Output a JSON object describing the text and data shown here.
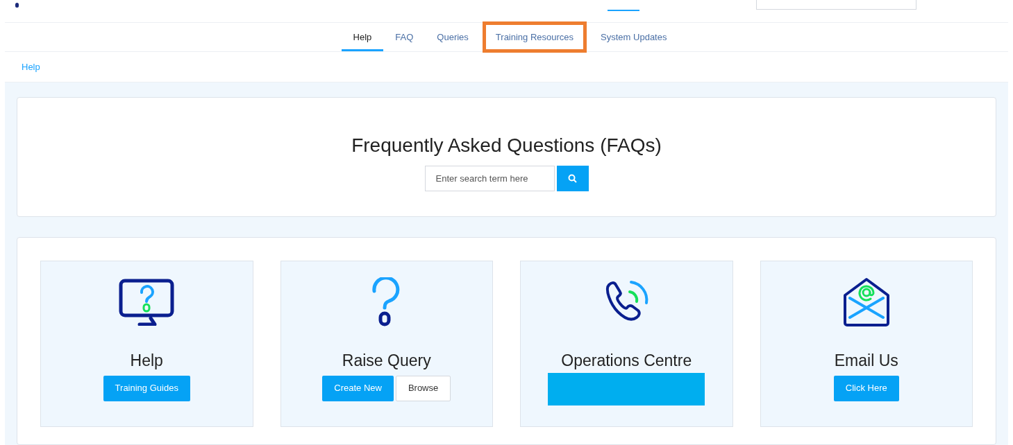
{
  "tabs": [
    {
      "label": "Help",
      "selected": true,
      "highlighted": false
    },
    {
      "label": "FAQ",
      "selected": false,
      "highlighted": false
    },
    {
      "label": "Queries",
      "selected": false,
      "highlighted": false
    },
    {
      "label": "Training Resources",
      "selected": false,
      "highlighted": true
    },
    {
      "label": "System Updates",
      "selected": false,
      "highlighted": false
    }
  ],
  "breadcrumb": "Help",
  "faq": {
    "title": "Frequently Asked Questions (FAQs)",
    "search": {
      "placeholder": "Enter search term here"
    }
  },
  "cards": [
    {
      "kind": "monitor",
      "title": "Help",
      "buttons": [
        {
          "label": "Training Guides",
          "primary": true
        }
      ]
    },
    {
      "kind": "question",
      "title": "Raise Query",
      "buttons": [
        {
          "label": "Create New",
          "primary": true
        },
        {
          "label": "Browse",
          "primary": false
        }
      ]
    },
    {
      "kind": "phone",
      "title": "Operations Centre",
      "redacted": true
    },
    {
      "kind": "mail",
      "title": "Email Us",
      "buttons": [
        {
          "label": "Click Here",
          "primary": true
        }
      ]
    }
  ]
}
